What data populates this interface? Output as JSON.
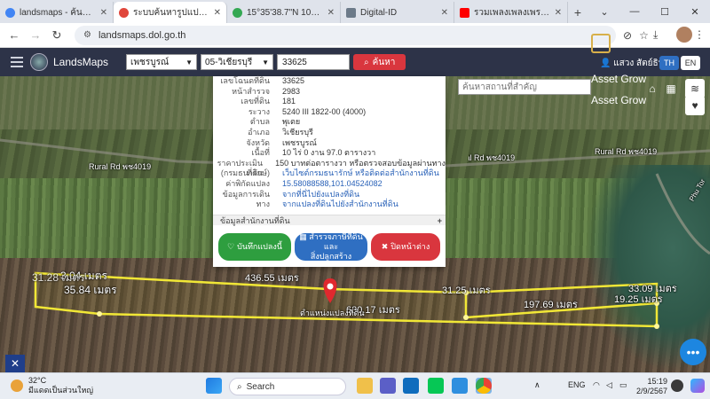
{
  "browser": {
    "tabs": [
      {
        "label": "landsmaps - ค้นหาด้วย Go",
        "color": "#4285f4",
        "active": false
      },
      {
        "label": "ระบบค้นหารูปแปลงที่ดิน (Lan",
        "color": "#e0463b",
        "active": true
      },
      {
        "label": "15°35'38.7\"N 101°03'38.",
        "color": "#34a853",
        "active": false
      },
      {
        "label": "Digital-ID",
        "color": "#6c7a89",
        "active": false
      },
      {
        "label": "รวมเพลงเพลงเพราะฟังสบาย...",
        "color": "#ff0000",
        "active": false
      }
    ],
    "url": "landsmaps.dol.go.th"
  },
  "app": {
    "name": "LandsMaps",
    "province": "เพชรบูรณ์",
    "district": "05-วิเชียรบุรี",
    "parcel_number": "33625",
    "search_label": "ค้นหา",
    "user_name": "แสวง สัตย์ธินย์",
    "lang_th": "TH",
    "lang_en": "EN"
  },
  "parcel": {
    "rows": [
      {
        "k": "เลขโฉนดที่ดิน",
        "v": "33625",
        "link": false
      },
      {
        "k": "หน้าสำรวจ",
        "v": "2983",
        "link": false
      },
      {
        "k": "เลขที่ดิน",
        "v": "181",
        "link": false
      },
      {
        "k": "ระวาง",
        "v": "5240 III 1822-00 (4000)",
        "link": false
      },
      {
        "k": "ตำบล",
        "v": "พุเตย",
        "link": false
      },
      {
        "k": "อำเภอ",
        "v": "วิเชียรบุรี",
        "link": false
      },
      {
        "k": "จังหวัด",
        "v": "เพชรบูรณ์",
        "link": false
      },
      {
        "k": "เนื้อที่",
        "v": "10 ไร่ 0 งาน 97.0 ตารางวา",
        "link": false
      },
      {
        "k": "ราคาประเมินที่ดิน",
        "v": "150 บาทต่อตารางวา หรือตรวจสอบข้อมูลผ่านทาง",
        "link": false
      },
      {
        "k": "(กรมธนารักษ์)",
        "v": "เว็บไซต์กรมธนารักษ์ หรือติดต่อสำนักงานที่ดิน",
        "link": true
      },
      {
        "k": "ค่าพิกัดแปลง",
        "v": "15.58088588,101.04524082",
        "link": true
      },
      {
        "k": "ข้อมูลการเดินทาง",
        "v": "จากที่นี่ไปยังแปลงที่ดิน",
        "link": true
      },
      {
        "k": "",
        "v": "จากแปลงที่ดินไปยังสำนักงานที่ดิน",
        "link": true
      }
    ],
    "section_title": "ข้อมูลสำนักงานที่ดิน",
    "btn_save": "บันทึกแปลงนี้",
    "btn_info_line1": "สำรวจภาษีที่ดินและ",
    "btn_info_line2": "สิ่งปลูกสร้าง",
    "btn_close": "ปิดหน้าต่าง"
  },
  "map": {
    "place_search_placeholder": "ค้นหาสถานที่สำคัญ",
    "asset_grow_1": "Asset Grow",
    "asset_grow_2": "Asset Grow",
    "asset_logo": "ASSET",
    "road_left": "Rural Rd พช4019",
    "road_right": "Rural Rd พช4019",
    "road_far_right": "Phu Tor",
    "marker_label": "ตำแหน่งแปลงที่ดิน",
    "measures": {
      "top": "436.55 เมตร",
      "bottom": "630.17 เมตร",
      "left_a": "3.04 เมตร",
      "left_b": "35.84 เมตร",
      "left_c": "31.28 เมตร",
      "mid_right": "31.25 เมตร",
      "inner": "197.69 เมตร",
      "right_a": "33.09 เมตร",
      "right_b": "19.25 เมตร"
    }
  },
  "taskbar": {
    "temp": "32°C",
    "weather": "มีแดดเป็นส่วนใหญ่",
    "search": "Search",
    "lang": "ENG",
    "time": "15:19",
    "date": "2/9/2567"
  }
}
